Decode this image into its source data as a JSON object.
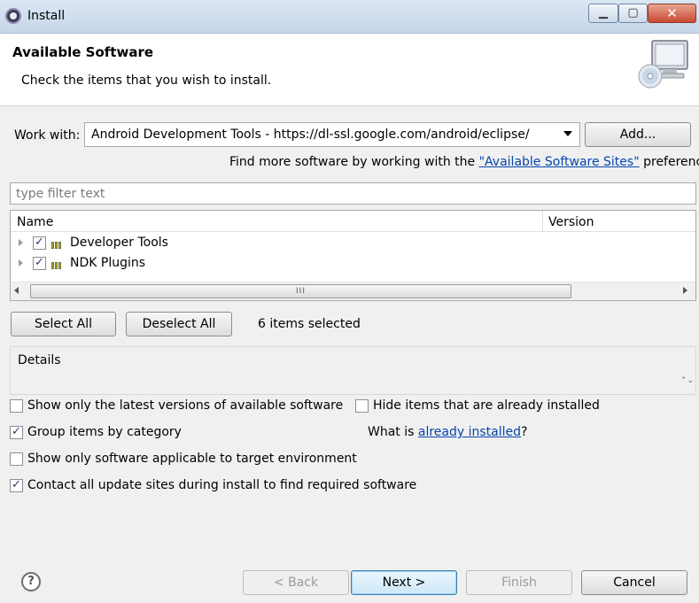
{
  "window": {
    "title": "Install",
    "minimize_glyph": "▁",
    "maximize_glyph": "▢",
    "close_glyph": "✕"
  },
  "header": {
    "title": "Available Software",
    "subtitle": "Check the items that you wish to install."
  },
  "work_with": {
    "label": "Work with:",
    "value": "Android Development Tools - https://dl-ssl.google.com/android/eclipse/",
    "add_label": "Add...",
    "find_more_prefix": "Find more software by working with the ",
    "find_more_link": "\"Available Software Sites\"",
    "find_more_suffix": " preferences."
  },
  "filter": {
    "placeholder": "type filter text"
  },
  "tree": {
    "columns": [
      "Name",
      "Version"
    ],
    "items": [
      {
        "label": "Developer Tools",
        "checked": "✓"
      },
      {
        "label": "NDK Plugins",
        "checked": "✓"
      }
    ],
    "scroll_thumb_glyph": "III"
  },
  "selection": {
    "select_all": "Select All",
    "deselect_all": "Deselect All",
    "count_text": "6 items selected"
  },
  "details": {
    "label": "Details",
    "scroll_glyph": "⌃⌄"
  },
  "options": {
    "latest_versions": {
      "label": "Show only the latest versions of available software",
      "checked": ""
    },
    "hide_installed": {
      "label": "Hide items that are already installed",
      "checked": ""
    },
    "group_by_category": {
      "label": "Group items by category",
      "checked": "✓"
    },
    "applicable_only": {
      "label": "Show only software applicable to target environment",
      "checked": ""
    },
    "contact_update_sites": {
      "label": "Contact all update sites during install to find required software",
      "checked": "✓"
    },
    "what_is_prefix": "What is ",
    "what_is_link": "already installed",
    "what_is_suffix": "?"
  },
  "footer": {
    "help_glyph": "?",
    "back": "< Back",
    "next": "Next >",
    "finish": "Finish",
    "cancel": "Cancel"
  }
}
